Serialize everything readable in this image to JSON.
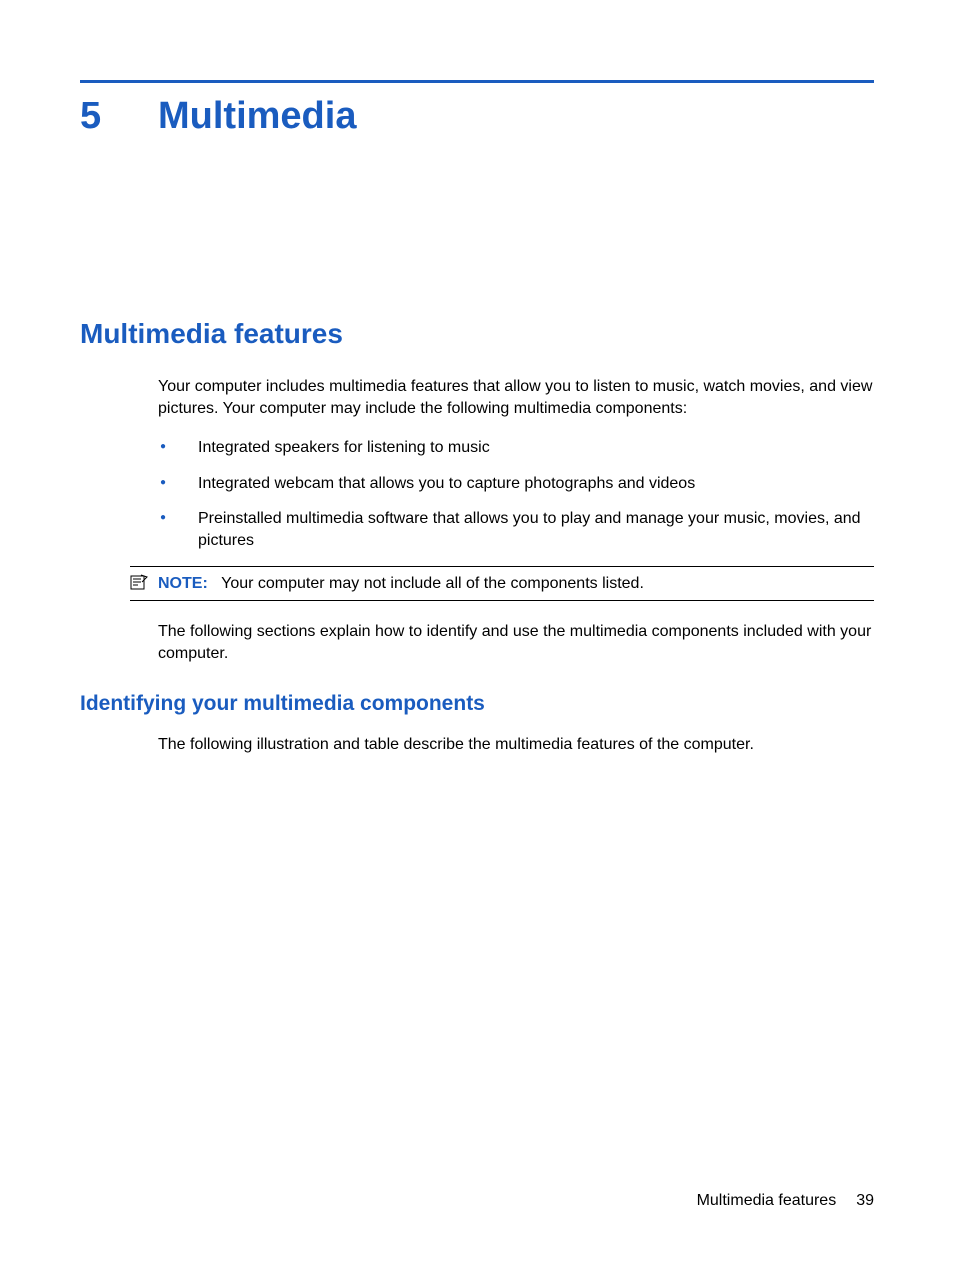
{
  "chapter": {
    "number": "5",
    "title": "Multimedia"
  },
  "section": {
    "heading": "Multimedia features",
    "intro": "Your computer includes multimedia features that allow you to listen to music, watch movies, and view pictures. Your computer may include the following multimedia components:",
    "bullets": [
      "Integrated speakers for listening to music",
      "Integrated webcam that allows you to capture photographs and videos",
      "Preinstalled multimedia software that allows you to play and manage your music, movies, and pictures"
    ],
    "note": {
      "label": "NOTE:",
      "text": "Your computer may not include all of the components listed."
    },
    "outro": "The following sections explain how to identify and use the multimedia components included with your computer."
  },
  "subsection": {
    "heading": "Identifying your multimedia components",
    "text": "The following illustration and table describe the multimedia features of the computer."
  },
  "footer": {
    "title": "Multimedia features",
    "page": "39"
  }
}
